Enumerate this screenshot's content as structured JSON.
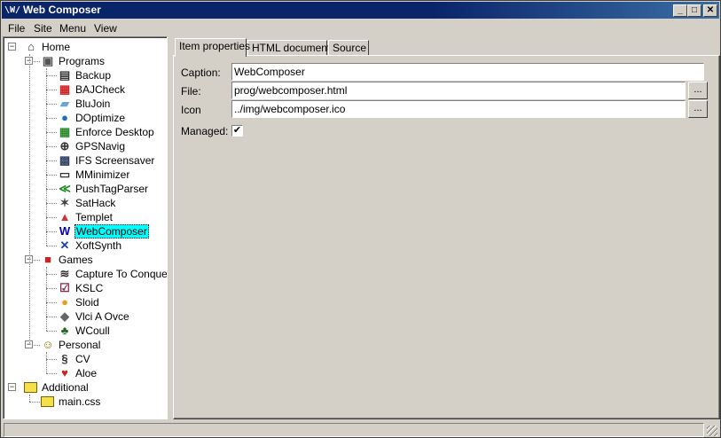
{
  "window": {
    "title": "Web Composer",
    "app_icon": "\\W/"
  },
  "menu": [
    {
      "label": "File",
      "accel": "F"
    },
    {
      "label": "Site",
      "accel": "S"
    },
    {
      "label": "Menu",
      "accel": "M"
    },
    {
      "label": "View",
      "accel": "V"
    }
  ],
  "tree": {
    "home": "Home",
    "programs": "Programs",
    "programs_items": [
      "Backup",
      "BAJCheck",
      "BluJoin",
      "DOptimize",
      "Enforce Desktop",
      "GPSNavig",
      "IFS Screensaver",
      "MMinimizer",
      "PushTagParser",
      "SatHack",
      "Templet",
      "WebComposer",
      "XoftSynth"
    ],
    "games": "Games",
    "games_items": [
      "Capture To Conquer",
      "KSLC",
      "Sloid",
      "Vlci A Ovce",
      "WCoull"
    ],
    "personal": "Personal",
    "personal_items": [
      "CV",
      "Aloe"
    ],
    "additional": "Additional",
    "additional_items": [
      "main.css"
    ],
    "selected": "WebComposer"
  },
  "tabs": [
    "Item properties",
    "HTML document",
    "Source"
  ],
  "form": {
    "caption_label": "Caption:",
    "caption_value": "WebComposer",
    "file_label": "File:",
    "file_value": "prog/webcomposer.html",
    "icon_label": "Icon",
    "icon_value": "../img/webcomposer.ico",
    "managed_label": "Managed:",
    "browse": "...",
    "managed_mark": "✔"
  }
}
